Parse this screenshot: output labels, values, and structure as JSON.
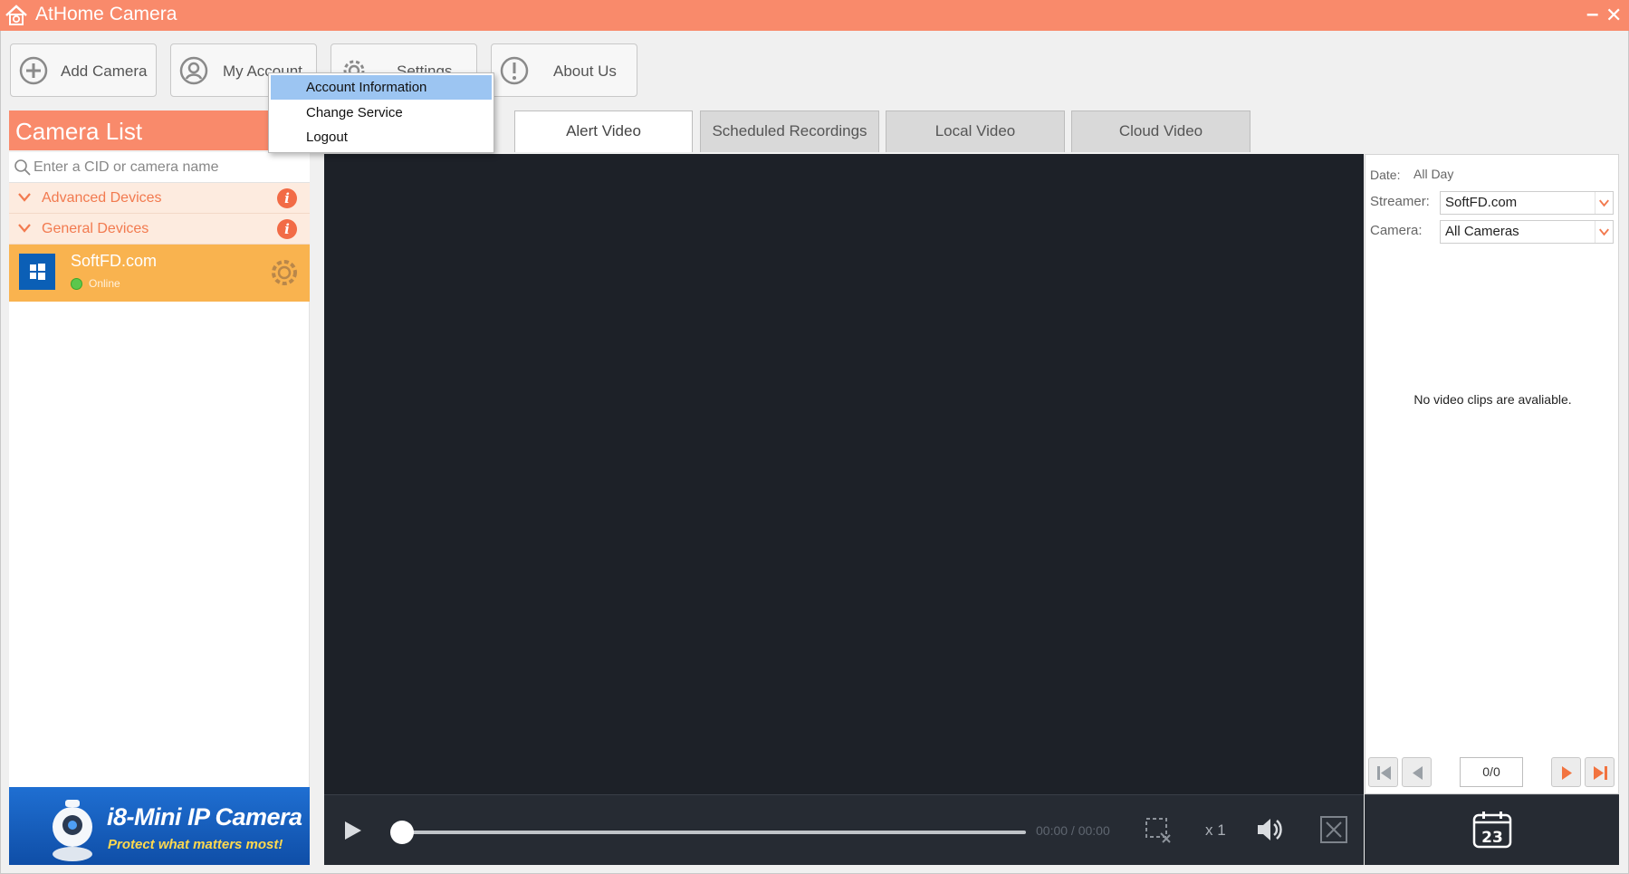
{
  "window": {
    "title": "AtHome Camera",
    "minimize_glyph": "–",
    "close_glyph": "✕",
    "accent_color": "#f98a6b"
  },
  "toolbar": {
    "add_camera": "Add Camera",
    "my_account": "My Account",
    "settings": "Settings",
    "about_us": "About Us"
  },
  "account_menu": {
    "items": [
      "Account Information",
      "Change Service",
      "Logout"
    ],
    "active_index": 0
  },
  "camera_list": {
    "title": "Camera List",
    "search_placeholder": "Enter a CID or camera name",
    "groups": [
      {
        "label": "Advanced Devices",
        "info_icon": "i"
      },
      {
        "label": "General Devices",
        "info_icon": "i"
      }
    ],
    "cameras": [
      {
        "name": "SoftFD.com",
        "status": "Online",
        "status_color": "#5cc74c"
      }
    ]
  },
  "ad_banner": {
    "headline": "i8-Mini IP Camera",
    "tagline": "Protect what matters most!"
  },
  "tabs": [
    {
      "label": "Alert Video",
      "active": true
    },
    {
      "label": "Scheduled Recordings",
      "active": false
    },
    {
      "label": "Local Video",
      "active": false
    },
    {
      "label": "Cloud Video",
      "active": false
    }
  ],
  "player": {
    "time": "00:00 / 00:00",
    "speed": "x 1",
    "progress": 0
  },
  "filter_panel": {
    "date_label": "Date:",
    "date_value": "All Day",
    "streamer_label": "Streamer:",
    "streamer_value": "SoftFD.com",
    "camera_label": "Camera:",
    "camera_value": "All Cameras",
    "empty_message": "No video clips are avaliable.",
    "page_indicator": "0/0",
    "calendar_day": "23"
  }
}
